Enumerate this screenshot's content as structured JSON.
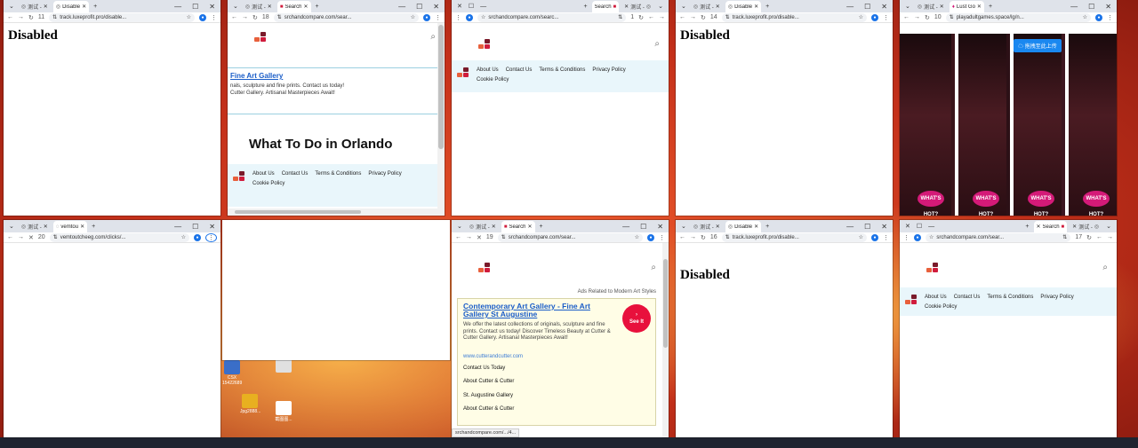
{
  "tab_test": "测试 -",
  "tab_disabled": "Disable",
  "tab_search": "Search",
  "tab_vem": "vemtou",
  "tab_lust": "Lust Go",
  "url_luxe": "track.luxeprofit.pro/disable...",
  "url_srch": "srchandcompare.com/sear...",
  "url_srch_short": "srchandcompare.com/searc...",
  "url_vem": "vemtoutcheeg.com/clicks/...",
  "url_game": "playadultgames.space/lg/n...",
  "ext_11": "11",
  "ext_18": "18",
  "ext_1": "1",
  "ext_14": "14",
  "ext_10": "10",
  "ext_20": "20",
  "ext_19": "19",
  "ext_16": "16",
  "ext_17": "17",
  "disabled_text": "Disabled",
  "nav": {
    "about": "About Us",
    "contact": "Contact Us",
    "terms": "Terms & Conditions",
    "privacy": "Privacy Policy",
    "cookie": "Cookie Policy"
  },
  "w2": {
    "ad_title": "Fine Art Gallery",
    "ad_line1": "nals, sculpture and fine prints. Contact us today!",
    "ad_line2": "Cutter Gallery. Artisanal Masterpieces Await!",
    "heading": "What To Do in Orlando"
  },
  "w7": {
    "ads_related": "Ads Related to Modern Art Styles",
    "ad_title": "Contemporary Art Gallery - Fine Art Gallery St Augustine",
    "ad_desc": "We offer the latest collections of originals, sculpture and fine prints. Contact us today! Discover Timeless Beauty at Cutter & Cutter Gallery. Artisanal Masterpieces Await!",
    "ad_url": "www.cutterandcutter.com",
    "see_it": "See It",
    "links": [
      "Contact Us Today",
      "About Cutter & Cutter",
      "St. Augustine Gallery",
      "About Cutter & Cutter"
    ],
    "status": "srchandcompare.com/.../4..."
  },
  "w5": {
    "upload": "拖拽至此上传",
    "badge": "WHAT'S HOT?"
  },
  "desktop": {
    "ic1": "CSX 15422689",
    "ic2": "Jpg2888...",
    "ic3": "截图图..."
  },
  "colors": {
    "logo_red": "#d01c3c",
    "logo_orange": "#e8603c",
    "logo_dark": "#7a1a2a",
    "accent_blue": "#1a73e8"
  }
}
